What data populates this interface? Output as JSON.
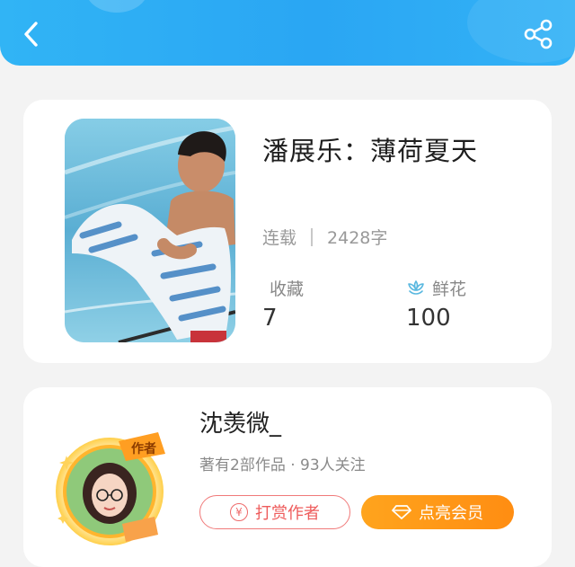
{
  "header": {
    "back_icon": "chevron-left-icon",
    "share_icon": "share-icon",
    "gradient_colors": [
      "#31b4f5",
      "#2aa6f3"
    ]
  },
  "book": {
    "title": "潘展乐：薄荷夏天",
    "status": "连载",
    "word_count": "2428字",
    "favorites_label": "收藏",
    "favorites_value": "7",
    "flowers_label": "鲜花",
    "flowers_value": "100",
    "flower_icon": "flower-icon",
    "accent_color": "#5ab8e0"
  },
  "author": {
    "name": "沈羡微_",
    "stats": "著有2部作品 · 93人关注",
    "avatar_badge": "作者",
    "tip_button": "打赏作者",
    "tip_icon": "yen-icon",
    "vip_button": "点亮会员",
    "vip_icon": "diamond-icon",
    "tip_color": "#ee5c5c",
    "vip_color": "#ff9a18"
  }
}
